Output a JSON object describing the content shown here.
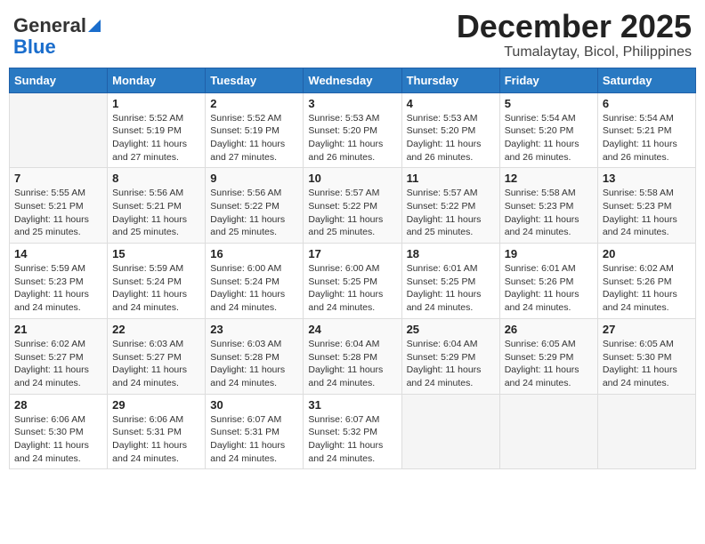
{
  "header": {
    "logo_general": "General",
    "logo_blue": "Blue",
    "month": "December 2025",
    "location": "Tumalaytay, Bicol, Philippines"
  },
  "days_of_week": [
    "Sunday",
    "Monday",
    "Tuesday",
    "Wednesday",
    "Thursday",
    "Friday",
    "Saturday"
  ],
  "weeks": [
    [
      {
        "day": "",
        "sunrise": "",
        "sunset": "",
        "daylight": ""
      },
      {
        "day": "1",
        "sunrise": "Sunrise: 5:52 AM",
        "sunset": "Sunset: 5:19 PM",
        "daylight": "Daylight: 11 hours and 27 minutes."
      },
      {
        "day": "2",
        "sunrise": "Sunrise: 5:52 AM",
        "sunset": "Sunset: 5:19 PM",
        "daylight": "Daylight: 11 hours and 27 minutes."
      },
      {
        "day": "3",
        "sunrise": "Sunrise: 5:53 AM",
        "sunset": "Sunset: 5:20 PM",
        "daylight": "Daylight: 11 hours and 26 minutes."
      },
      {
        "day": "4",
        "sunrise": "Sunrise: 5:53 AM",
        "sunset": "Sunset: 5:20 PM",
        "daylight": "Daylight: 11 hours and 26 minutes."
      },
      {
        "day": "5",
        "sunrise": "Sunrise: 5:54 AM",
        "sunset": "Sunset: 5:20 PM",
        "daylight": "Daylight: 11 hours and 26 minutes."
      },
      {
        "day": "6",
        "sunrise": "Sunrise: 5:54 AM",
        "sunset": "Sunset: 5:21 PM",
        "daylight": "Daylight: 11 hours and 26 minutes."
      }
    ],
    [
      {
        "day": "7",
        "sunrise": "Sunrise: 5:55 AM",
        "sunset": "Sunset: 5:21 PM",
        "daylight": "Daylight: 11 hours and 25 minutes."
      },
      {
        "day": "8",
        "sunrise": "Sunrise: 5:56 AM",
        "sunset": "Sunset: 5:21 PM",
        "daylight": "Daylight: 11 hours and 25 minutes."
      },
      {
        "day": "9",
        "sunrise": "Sunrise: 5:56 AM",
        "sunset": "Sunset: 5:22 PM",
        "daylight": "Daylight: 11 hours and 25 minutes."
      },
      {
        "day": "10",
        "sunrise": "Sunrise: 5:57 AM",
        "sunset": "Sunset: 5:22 PM",
        "daylight": "Daylight: 11 hours and 25 minutes."
      },
      {
        "day": "11",
        "sunrise": "Sunrise: 5:57 AM",
        "sunset": "Sunset: 5:22 PM",
        "daylight": "Daylight: 11 hours and 25 minutes."
      },
      {
        "day": "12",
        "sunrise": "Sunrise: 5:58 AM",
        "sunset": "Sunset: 5:23 PM",
        "daylight": "Daylight: 11 hours and 24 minutes."
      },
      {
        "day": "13",
        "sunrise": "Sunrise: 5:58 AM",
        "sunset": "Sunset: 5:23 PM",
        "daylight": "Daylight: 11 hours and 24 minutes."
      }
    ],
    [
      {
        "day": "14",
        "sunrise": "Sunrise: 5:59 AM",
        "sunset": "Sunset: 5:23 PM",
        "daylight": "Daylight: 11 hours and 24 minutes."
      },
      {
        "day": "15",
        "sunrise": "Sunrise: 5:59 AM",
        "sunset": "Sunset: 5:24 PM",
        "daylight": "Daylight: 11 hours and 24 minutes."
      },
      {
        "day": "16",
        "sunrise": "Sunrise: 6:00 AM",
        "sunset": "Sunset: 5:24 PM",
        "daylight": "Daylight: 11 hours and 24 minutes."
      },
      {
        "day": "17",
        "sunrise": "Sunrise: 6:00 AM",
        "sunset": "Sunset: 5:25 PM",
        "daylight": "Daylight: 11 hours and 24 minutes."
      },
      {
        "day": "18",
        "sunrise": "Sunrise: 6:01 AM",
        "sunset": "Sunset: 5:25 PM",
        "daylight": "Daylight: 11 hours and 24 minutes."
      },
      {
        "day": "19",
        "sunrise": "Sunrise: 6:01 AM",
        "sunset": "Sunset: 5:26 PM",
        "daylight": "Daylight: 11 hours and 24 minutes."
      },
      {
        "day": "20",
        "sunrise": "Sunrise: 6:02 AM",
        "sunset": "Sunset: 5:26 PM",
        "daylight": "Daylight: 11 hours and 24 minutes."
      }
    ],
    [
      {
        "day": "21",
        "sunrise": "Sunrise: 6:02 AM",
        "sunset": "Sunset: 5:27 PM",
        "daylight": "Daylight: 11 hours and 24 minutes."
      },
      {
        "day": "22",
        "sunrise": "Sunrise: 6:03 AM",
        "sunset": "Sunset: 5:27 PM",
        "daylight": "Daylight: 11 hours and 24 minutes."
      },
      {
        "day": "23",
        "sunrise": "Sunrise: 6:03 AM",
        "sunset": "Sunset: 5:28 PM",
        "daylight": "Daylight: 11 hours and 24 minutes."
      },
      {
        "day": "24",
        "sunrise": "Sunrise: 6:04 AM",
        "sunset": "Sunset: 5:28 PM",
        "daylight": "Daylight: 11 hours and 24 minutes."
      },
      {
        "day": "25",
        "sunrise": "Sunrise: 6:04 AM",
        "sunset": "Sunset: 5:29 PM",
        "daylight": "Daylight: 11 hours and 24 minutes."
      },
      {
        "day": "26",
        "sunrise": "Sunrise: 6:05 AM",
        "sunset": "Sunset: 5:29 PM",
        "daylight": "Daylight: 11 hours and 24 minutes."
      },
      {
        "day": "27",
        "sunrise": "Sunrise: 6:05 AM",
        "sunset": "Sunset: 5:30 PM",
        "daylight": "Daylight: 11 hours and 24 minutes."
      }
    ],
    [
      {
        "day": "28",
        "sunrise": "Sunrise: 6:06 AM",
        "sunset": "Sunset: 5:30 PM",
        "daylight": "Daylight: 11 hours and 24 minutes."
      },
      {
        "day": "29",
        "sunrise": "Sunrise: 6:06 AM",
        "sunset": "Sunset: 5:31 PM",
        "daylight": "Daylight: 11 hours and 24 minutes."
      },
      {
        "day": "30",
        "sunrise": "Sunrise: 6:07 AM",
        "sunset": "Sunset: 5:31 PM",
        "daylight": "Daylight: 11 hours and 24 minutes."
      },
      {
        "day": "31",
        "sunrise": "Sunrise: 6:07 AM",
        "sunset": "Sunset: 5:32 PM",
        "daylight": "Daylight: 11 hours and 24 minutes."
      },
      {
        "day": "",
        "sunrise": "",
        "sunset": "",
        "daylight": ""
      },
      {
        "day": "",
        "sunrise": "",
        "sunset": "",
        "daylight": ""
      },
      {
        "day": "",
        "sunrise": "",
        "sunset": "",
        "daylight": ""
      }
    ]
  ]
}
